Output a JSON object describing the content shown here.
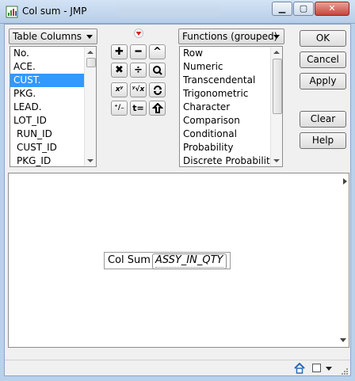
{
  "window": {
    "title": "Col sum - JMP",
    "controls": [
      "minimize-icon",
      "maximize-icon",
      "close-icon"
    ]
  },
  "table_columns": {
    "dropdown_label": "Table Columns",
    "items": [
      "No.",
      "ACE.",
      "CUST.",
      "PKG.",
      "LEAD.",
      "LOT_ID",
      "RUN_ID",
      "CUST_ID",
      "PKG_ID"
    ],
    "selected": "CUST."
  },
  "functions": {
    "dropdown_label": "Functions (grouped)",
    "items": [
      "Row",
      "Numeric",
      "Transcendental",
      "Trigonometric",
      "Character",
      "Comparison",
      "Conditional",
      "Probability",
      "Discrete Probability"
    ]
  },
  "keypad": {
    "menu_icon": "red-down-arrow-icon",
    "row1": [
      "+",
      "−",
      "^"
    ],
    "row2": [
      "×",
      "÷",
      "root"
    ],
    "row3": [
      "x^y",
      "y-root-x",
      "swap"
    ],
    "row4": [
      "+/-",
      "t=",
      "local"
    ]
  },
  "buttons": {
    "ok": "OK",
    "cancel": "Cancel",
    "apply": "Apply",
    "clear": "Clear",
    "help": "Help"
  },
  "formula": {
    "function": "Col Sum",
    "argument": "ASSY_IN_QTY"
  },
  "status_icons": [
    "home-icon",
    "box-icon",
    "dropdown-arrow-icon",
    "resize-grip-icon"
  ],
  "colors": {
    "selection": "#3399ff",
    "title_bar": "#c7d9ef",
    "close_button": "#c7453a",
    "keypad_menu_arrow": "#e02020"
  }
}
